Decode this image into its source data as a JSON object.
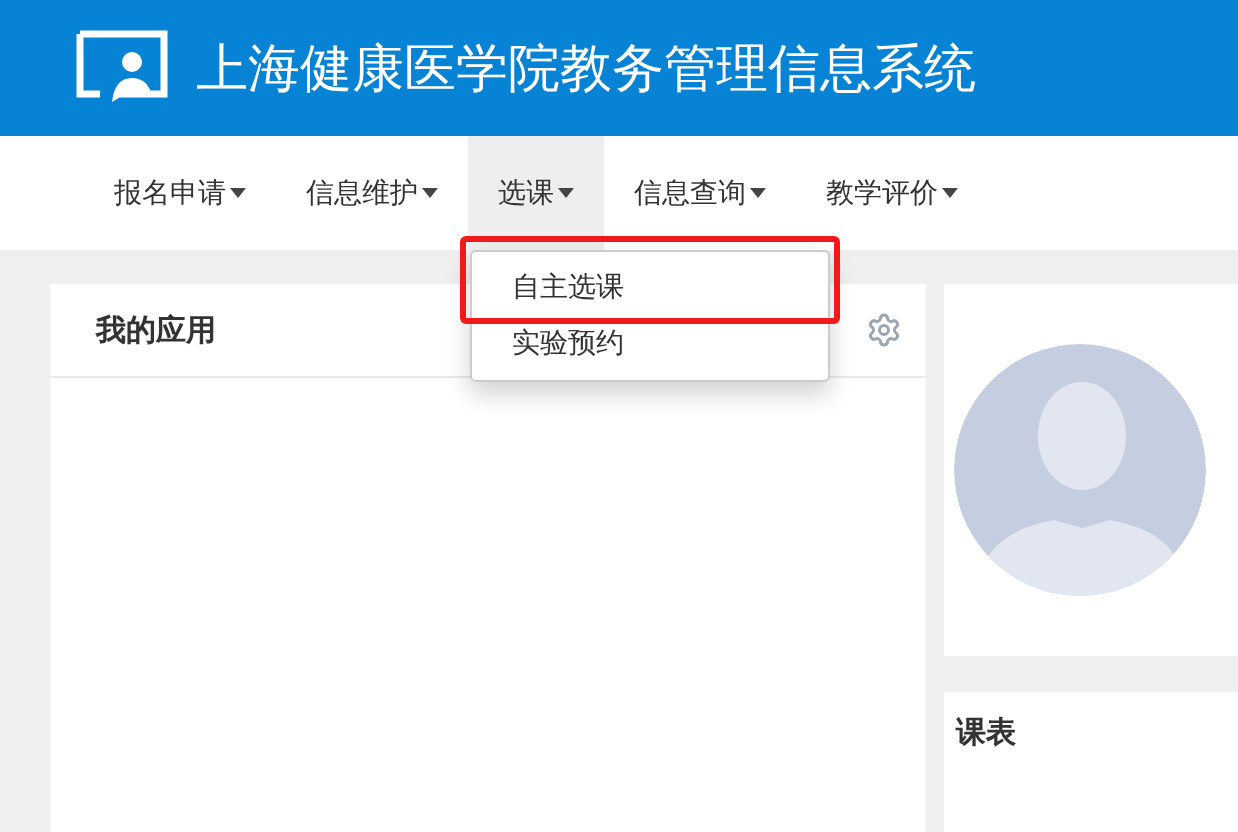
{
  "header": {
    "title": "上海健康医学院教务管理信息系统"
  },
  "nav": [
    {
      "label": "报名申请",
      "selected": false
    },
    {
      "label": "信息维护",
      "selected": false
    },
    {
      "label": "选课",
      "selected": true,
      "menu": [
        {
          "label": "自主选课",
          "highlighted": true
        },
        {
          "label": "实验预约",
          "highlighted": false
        }
      ]
    },
    {
      "label": "信息查询",
      "selected": false
    },
    {
      "label": "教学评价",
      "selected": false
    }
  ],
  "apps_panel": {
    "title": "我的应用"
  },
  "timetable_panel": {
    "title": "课表"
  }
}
